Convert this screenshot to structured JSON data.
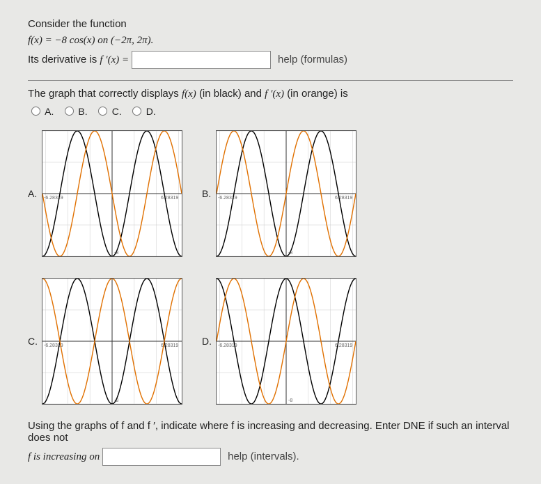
{
  "intro": "Consider the function",
  "function_def": "f(x) = −8 cos(x)   on (−2π, 2π).",
  "derivative_prompt_pre": "Its derivative is ",
  "derivative_prompt_math": "f ′(x) = ",
  "derivative_value": "",
  "help_formulas": "help (formulas)",
  "graph_question_pre": "The graph that correctly displays ",
  "graph_question_f": "f(x)",
  "graph_question_mid1": " (in black) and ",
  "graph_question_fp": "f ′(x)",
  "graph_question_mid2": " (in orange) is",
  "choices": {
    "a": "A.",
    "b": "B.",
    "c": "C.",
    "d": "D."
  },
  "graph_ticks": {
    "left": "-6.28319",
    "right": "6.28319",
    "bottom": "-8"
  },
  "using_graphs_text": "Using the graphs of f and f ′, indicate where f is increasing and decreasing. Enter DNE if such an interval does not",
  "increasing_label": "f is increasing on ",
  "increasing_value": "",
  "help_intervals": "help (intervals).",
  "chart_data": [
    {
      "label": "A",
      "type": "line",
      "x_range": [
        -6.28319,
        6.28319
      ],
      "y_range": [
        -8,
        8
      ],
      "series": [
        {
          "name": "f(x)",
          "color": "black",
          "formula": "-8*cos(x)"
        },
        {
          "name": "f'(x)",
          "color": "orange",
          "formula": "-8*sin(x)"
        }
      ]
    },
    {
      "label": "B",
      "type": "line",
      "x_range": [
        -6.28319,
        6.28319
      ],
      "y_range": [
        -8,
        8
      ],
      "series": [
        {
          "name": "f(x)",
          "color": "black",
          "formula": "-8*cos(x)"
        },
        {
          "name": "f'(x)",
          "color": "orange",
          "formula": "8*sin(x)"
        }
      ]
    },
    {
      "label": "C",
      "type": "line",
      "x_range": [
        -6.28319,
        6.28319
      ],
      "y_range": [
        -8,
        8
      ],
      "series": [
        {
          "name": "f(x)",
          "color": "black",
          "formula": "-8*cos(x)"
        },
        {
          "name": "f'(x)",
          "color": "orange",
          "formula": "8*cos(x)"
        }
      ]
    },
    {
      "label": "D",
      "type": "line",
      "x_range": [
        -6.28319,
        6.28319
      ],
      "y_range": [
        -8,
        8
      ],
      "series": [
        {
          "name": "f(x)",
          "color": "black",
          "formula": "8*cos(x)"
        },
        {
          "name": "f'(x)",
          "color": "orange",
          "formula": "8*sin(x)"
        }
      ]
    }
  ]
}
